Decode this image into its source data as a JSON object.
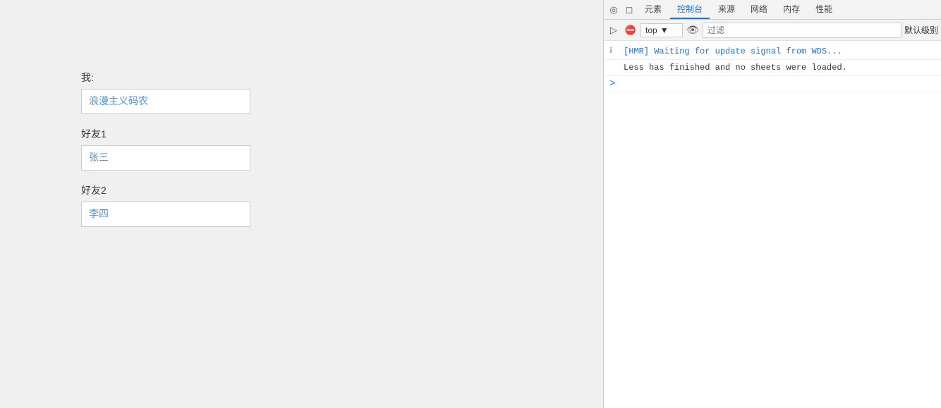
{
  "app": {
    "me_label": "我:",
    "me_value": "浪漫主义码农",
    "friend1_label": "好友1",
    "friend1_value": "张三",
    "friend2_label": "好友2",
    "friend2_value": "李四"
  },
  "devtools": {
    "tabs": [
      {
        "label": "元素",
        "active": false
      },
      {
        "label": "控制台",
        "active": true
      },
      {
        "label": "来源",
        "active": false
      },
      {
        "label": "网络",
        "active": false
      },
      {
        "label": "内存",
        "active": false
      },
      {
        "label": "性能",
        "active": false
      }
    ],
    "toolbar": {
      "top_selector": "top",
      "filter_placeholder": "过滤",
      "log_level": "默认级别"
    },
    "console_lines": [
      {
        "type": "hmr",
        "text": "[HMR] Waiting for update signal from WDS..."
      },
      {
        "type": "info",
        "text": "Less has finished and no sheets were loaded."
      },
      {
        "type": "prompt",
        "text": ">"
      }
    ]
  }
}
